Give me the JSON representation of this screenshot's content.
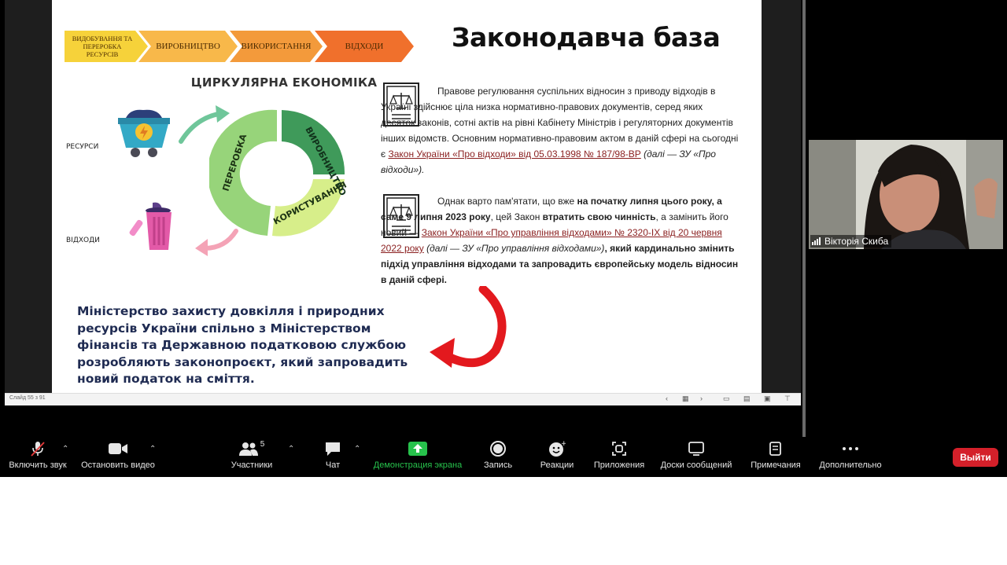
{
  "slide": {
    "process_steps": [
      {
        "label": "ВИДОБУВАННЯ ТА ПЕРЕРОБКА РЕСУРСІВ",
        "color": "#f6d23a"
      },
      {
        "label": "ВИРОБНИЦТВО",
        "color": "#f8b84a"
      },
      {
        "label": "ВИКОРИСТАННЯ",
        "color": "#f39a3b"
      },
      {
        "label": "ВІДХОДИ",
        "color": "#f0702c"
      }
    ],
    "title": "Законодавча база",
    "ce_title": "ЦИРКУЛЯРНА ЕКОНОМІКА",
    "label_resources": "РЕСУРСИ",
    "label_waste": "ВІДХОДИ",
    "cycle": {
      "production": "ВИРОБНИЦТВО",
      "usage": "КОРИСТУВАННЯ",
      "recycling": "ПЕРЕРОБКА"
    },
    "para1": {
      "text": "Правове регулювання суспільних відносин з приводу відходів в Україні здійснює ціла низка нормативно-правових документів, серед яких десяток законів, сотні актів на рівні Кабінету Міністрів і регуляторних документів інших відомств. Основним нормативно-правовим актом в даній сфері на сьогодні є ",
      "link": "Закон України «Про відходи» від 05.03.1998 № 187/98-ВР",
      "suffix": " (далі — ЗУ «Про відходи»)."
    },
    "para2": {
      "t1": "Однак варто пам'ятати, що вже ",
      "b1": "на початку липня цього року, а саме 9 липня 2023 року",
      "t2": ", цей Закон ",
      "b2": "втратить свою чинність",
      "t3": ", а замінить його новий — ",
      "link": "Закон України «Про управління відходами» № 2320-IX від 20 червня 2022 року",
      "i1": " (далі — ЗУ «Про управління відходами»)",
      "b3": ", який кардинально змінить підхід управління відходами та запровадить європейську модель відносин в даній сфері."
    },
    "bottom_text": "Міністерство захисту довкілля і природних ресурсів України спільно з Міністерством фінансів та Державною податковою службою розробляють законопроєкт, який запровадить новий податок на сміття."
  },
  "ppt_status": {
    "slide_counter": "Слайд 55 з 91"
  },
  "webcam": {
    "participant_name": "Вікторія Скиба"
  },
  "toolbar": {
    "audio": "Включить звук",
    "video": "Остановить видео",
    "participants": "Участники",
    "participants_count": "5",
    "chat": "Чат",
    "share": "Демонстрация экрана",
    "record": "Запись",
    "reactions": "Реакции",
    "apps": "Приложения",
    "whiteboards": "Доски сообщений",
    "notes": "Примечания",
    "more": "Дополнительно",
    "leave": "Выйти"
  },
  "colors": {
    "share_green": "#27c24c",
    "leave_red": "#d4202a",
    "link_red": "#8a1f1f",
    "navy_text": "#1f2b52"
  }
}
